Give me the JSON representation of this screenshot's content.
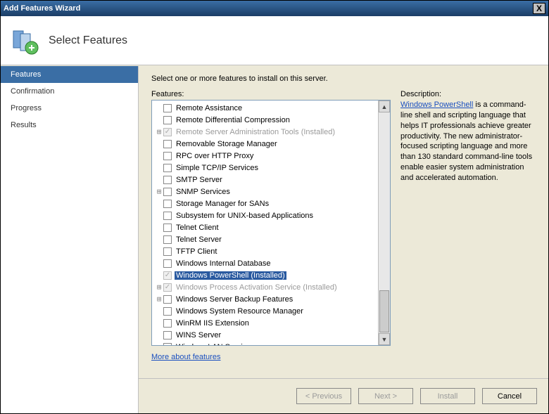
{
  "window": {
    "title": "Add Features Wizard",
    "close_label": "X"
  },
  "header": {
    "heading": "Select Features"
  },
  "sidebar": {
    "steps": [
      "Features",
      "Confirmation",
      "Progress",
      "Results"
    ],
    "active_index": 0
  },
  "main": {
    "intro": "Select one or more features to install on this server.",
    "features_label": "Features:",
    "more_link": "More about features",
    "items": [
      {
        "label": "Remote Assistance"
      },
      {
        "label": "Remote Differential Compression"
      },
      {
        "label": "Remote Server Administration Tools  (Installed)",
        "expandable": true,
        "disabled": true,
        "checked": true
      },
      {
        "label": "Removable Storage Manager"
      },
      {
        "label": "RPC over HTTP Proxy"
      },
      {
        "label": "Simple TCP/IP Services"
      },
      {
        "label": "SMTP Server"
      },
      {
        "label": "SNMP Services",
        "expandable": true
      },
      {
        "label": "Storage Manager for SANs"
      },
      {
        "label": "Subsystem for UNIX-based Applications"
      },
      {
        "label": "Telnet Client"
      },
      {
        "label": "Telnet Server"
      },
      {
        "label": "TFTP Client"
      },
      {
        "label": "Windows Internal Database"
      },
      {
        "label": "Windows PowerShell  (Installed)",
        "disabled": true,
        "checked": true,
        "selected": true
      },
      {
        "label": "Windows Process Activation Service  (Installed)",
        "expandable": true,
        "disabled": true,
        "checked": true
      },
      {
        "label": "Windows Server Backup Features",
        "expandable": true
      },
      {
        "label": "Windows System Resource Manager"
      },
      {
        "label": "WinRM IIS Extension"
      },
      {
        "label": "WINS Server"
      },
      {
        "label": "Wireless LAN Service"
      }
    ]
  },
  "description": {
    "label": "Description:",
    "link_text": "Windows PowerShell",
    "body": " is a command-line shell and scripting language that helps IT professionals achieve greater productivity. The new administrator-focused scripting language and more than 130 standard command-line tools enable easier system administration and accelerated automation."
  },
  "buttons": {
    "previous": "< Previous",
    "next": "Next >",
    "install": "Install",
    "cancel": "Cancel"
  }
}
